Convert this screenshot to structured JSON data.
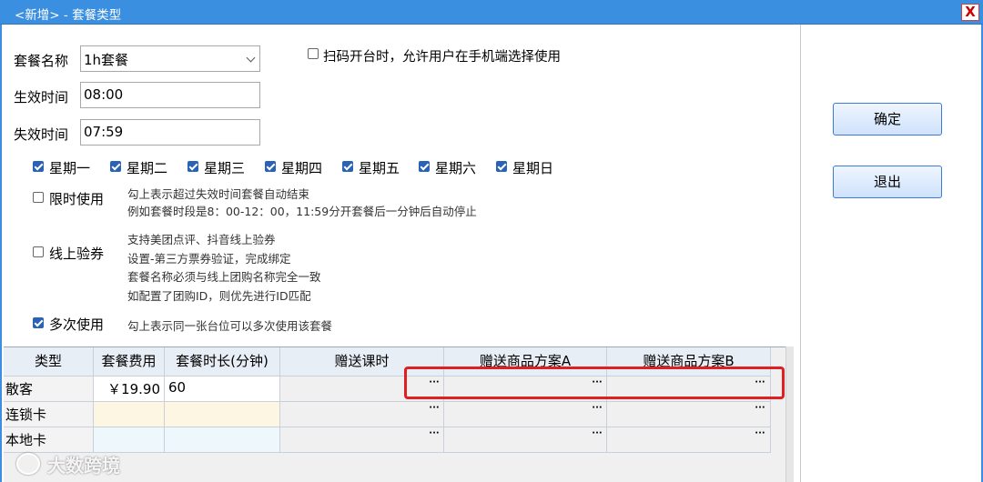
{
  "window": {
    "title": "<新增> - 套餐类型",
    "close": "X"
  },
  "form": {
    "name_label": "套餐名称",
    "name_value": "1h套餐",
    "start_label": "生效时间",
    "start_value": "08:00",
    "end_label": "失效时间",
    "end_value": "07:59",
    "scan_label": "扫码开台时，允许用户在手机端选择使用"
  },
  "weekdays": [
    "星期一",
    "星期二",
    "星期三",
    "星期四",
    "星期五",
    "星期六",
    "星期日"
  ],
  "options": {
    "limit_label": "限时使用",
    "limit_note1": "勾上表示超过失效时间套餐自动结束",
    "limit_note2": "例如套餐时段是8：00-12：00，11:59分开套餐后一分钟后自动停止",
    "online_label": "线上验券",
    "online_note1": "支持美团点评、抖音线上验券",
    "online_note2": "设置-第三方票券验证，完成绑定",
    "online_note3": "套餐名称必须与线上团购名称完全一致",
    "online_note4": "如配置了团购ID，则优先进行ID匹配",
    "multi_label": "多次使用",
    "multi_note": "勾上表示同一张台位可以多次使用该套餐"
  },
  "buttons": {
    "ok": "确定",
    "exit": "退出"
  },
  "table": {
    "headers": [
      "类型",
      "套餐费用",
      "套餐时长(分钟)",
      "赠送课时",
      "赠送商品方案A",
      "赠送商品方案B"
    ],
    "rows": [
      {
        "type": "散客",
        "fee": "￥19.90",
        "duration": "60"
      },
      {
        "type": "连锁卡",
        "fee": "",
        "duration": ""
      },
      {
        "type": "本地卡",
        "fee": "",
        "duration": ""
      }
    ],
    "dots": "···"
  },
  "watermark": "大数跨境"
}
